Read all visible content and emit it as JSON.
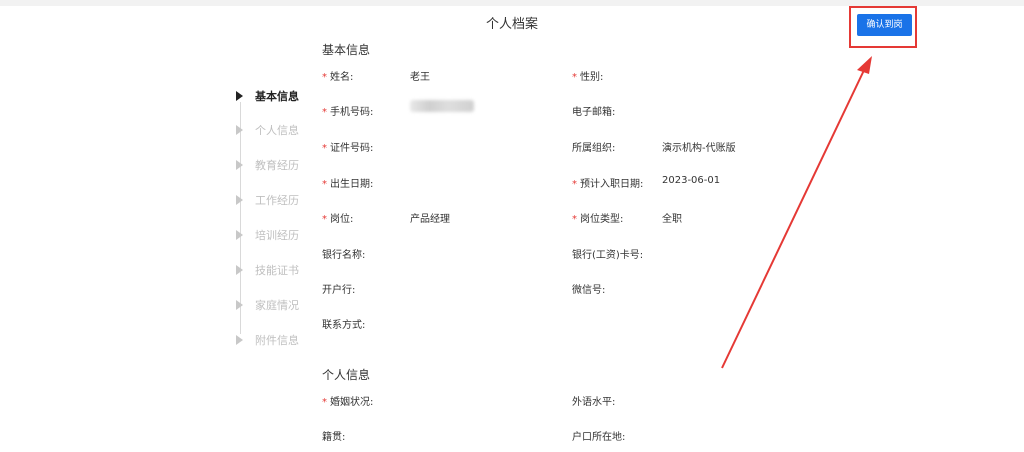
{
  "header": {
    "title": "个人档案",
    "confirm_label": "确认到岗"
  },
  "nav": {
    "items": [
      {
        "label": "基本信息",
        "active": true
      },
      {
        "label": "个人信息",
        "active": false
      },
      {
        "label": "教育经历",
        "active": false
      },
      {
        "label": "工作经历",
        "active": false
      },
      {
        "label": "培训经历",
        "active": false
      },
      {
        "label": "技能证书",
        "active": false
      },
      {
        "label": "家庭情况",
        "active": false
      },
      {
        "label": "附件信息",
        "active": false
      }
    ]
  },
  "basic": {
    "title": "基本信息",
    "name_label": "姓名:",
    "name_value": "老王",
    "gender_label": "性别:",
    "gender_value": "",
    "phone_label": "手机号码:",
    "email_label": "电子邮箱:",
    "id_label": "证件号码:",
    "org_label": "所属组织:",
    "org_value": "演示机构-代账版",
    "birth_label": "出生日期:",
    "entry_label": "预计入职日期:",
    "entry_value": "2023-06-01",
    "post_label": "岗位:",
    "post_value": "产品经理",
    "post_type_label": "岗位类型:",
    "post_type_value": "全职",
    "bank_label": "银行名称:",
    "bank_card_label": "银行(工资)卡号:",
    "branch_label": "开户行:",
    "wechat_label": "微信号:",
    "contact_label": "联系方式:"
  },
  "personal": {
    "title": "个人信息",
    "marital_label": "婚姻状况:",
    "language_label": "外语水平:",
    "native_label": "籍贯:",
    "hukou_label": "户口所在地:"
  }
}
